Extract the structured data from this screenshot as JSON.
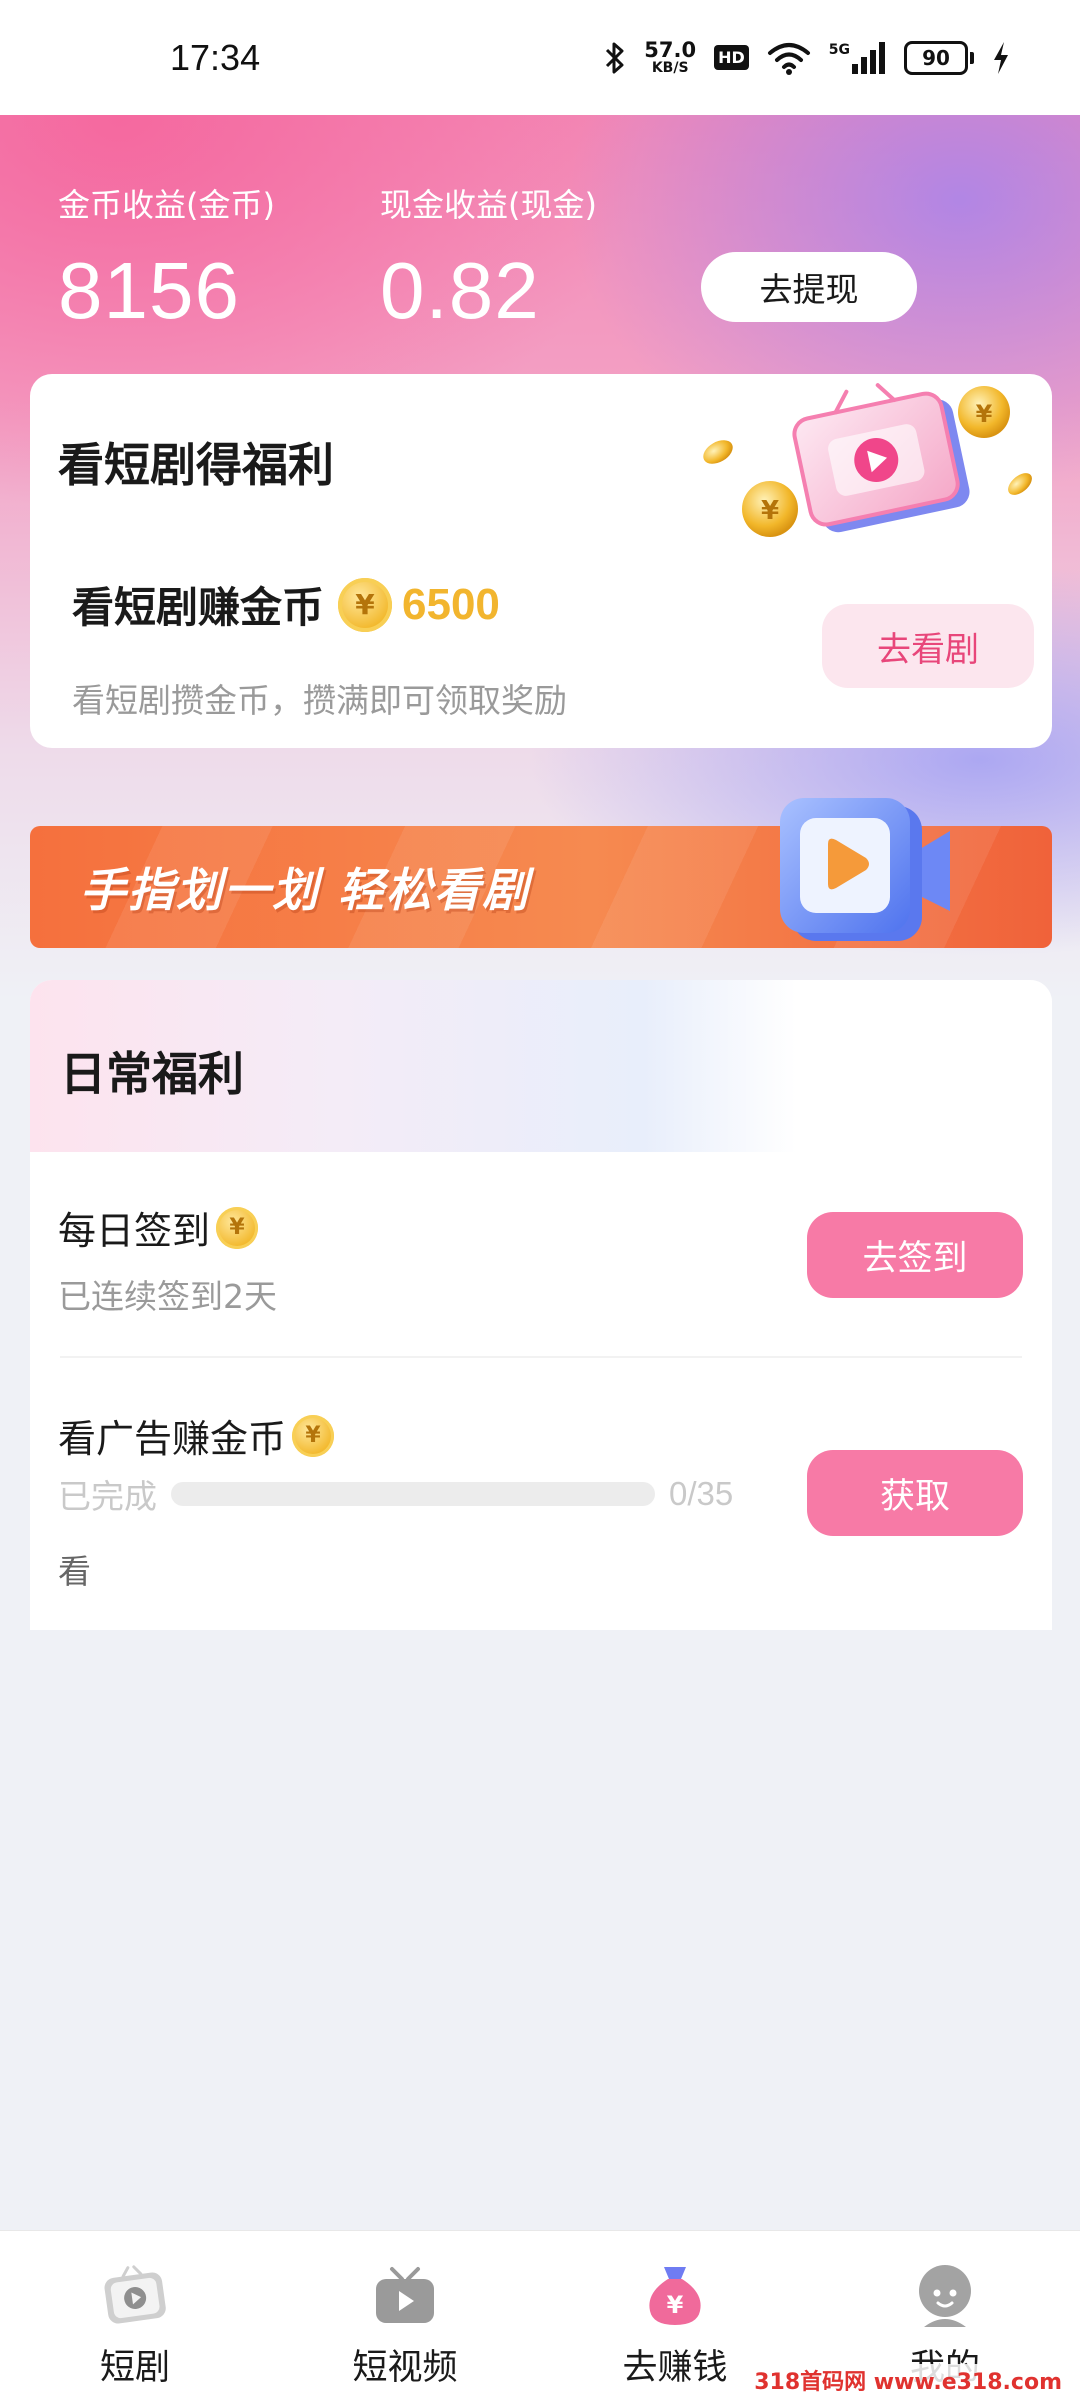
{
  "status_bar": {
    "time": "17:34",
    "net_speed_value": "57.0",
    "net_speed_unit": "KB/S",
    "hd_badge": "HD",
    "signal_label": "5G",
    "battery": "90",
    "icons": [
      "bluetooth-icon",
      "wifi-icon",
      "cell-signal-icon",
      "charging-icon"
    ]
  },
  "earnings": {
    "coin_label": "金币收益(金币)",
    "coin_value": "8156",
    "cash_label": "现金收益(现金)",
    "cash_value": "0.82",
    "withdraw_button": "去提现"
  },
  "drama_card": {
    "title": "看短剧得福利",
    "earn_text": "看短剧赚金币",
    "coin_amount": "6500",
    "subtitle": "看短剧攒金币，攒满即可领取奖励",
    "button": "去看剧"
  },
  "banner": {
    "text": "手指划一划 轻松看剧"
  },
  "daily": {
    "title": "日常福利",
    "tasks": [
      {
        "title": "每日签到",
        "subtitle": "已连续签到2天",
        "button": "去签到"
      },
      {
        "title": "看广告赚金币",
        "status_label": "已完成",
        "progress_text": "0/35",
        "progress_fraction": 0,
        "extra_text": "看",
        "button": "获取"
      }
    ]
  },
  "bottom_nav": {
    "items": [
      {
        "label": "短剧",
        "icon": "drama-icon"
      },
      {
        "label": "短视频",
        "icon": "tv-icon"
      },
      {
        "label": "去赚钱",
        "icon": "money-bag-icon",
        "active": true
      },
      {
        "label": "我的",
        "icon": "profile-icon"
      }
    ]
  },
  "watermark": "318首码网 www.e318.com",
  "colors": {
    "accent_pink": "#f77aa6",
    "coin_gold": "#f2b52e",
    "banner_orange": "#f5703d",
    "active_nav": "#f06a9b"
  }
}
